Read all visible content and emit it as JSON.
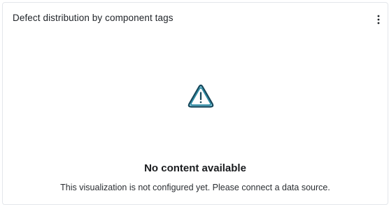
{
  "widget": {
    "title": "Defect distribution by component tags",
    "menu_icon": "more-vertical-icon",
    "empty_state": {
      "icon": "warning-triangle-icon",
      "icon_color": "#2a8aa3",
      "title": "No content available",
      "description": "This visualization is not configured yet. Please connect a data source."
    }
  }
}
